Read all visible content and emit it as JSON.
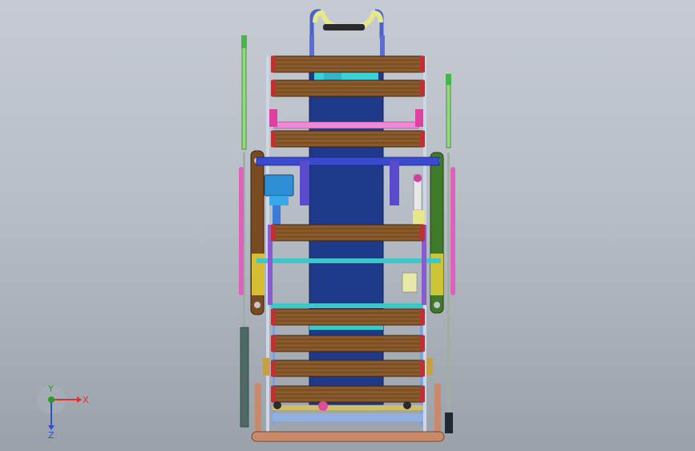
{
  "viewport": {
    "background_top": "#c6cbd3",
    "background_bottom": "#9aa1aa"
  },
  "triad": {
    "x_label": "X",
    "y_label": "Y",
    "z_label": "Z",
    "x_color": "#e03030",
    "y_color": "#2a9a2a",
    "z_color": "#2f4fd0"
  },
  "model": {
    "colors": {
      "tread_wood": "#8a5a2b",
      "tread_cap": "#c03030",
      "belt": "#1f3a8a",
      "side_rail_left": "#7a4a20",
      "side_rail_right": "#3f7a2a",
      "cyan_bar": "#3cc8c8",
      "blue_bar": "#3a4ad0",
      "pink_part": "#e060c0",
      "handle": "#e6e88a",
      "pole_green": "#8fdc7a",
      "base_copper": "#c88a6a"
    },
    "tread_count": 8
  }
}
